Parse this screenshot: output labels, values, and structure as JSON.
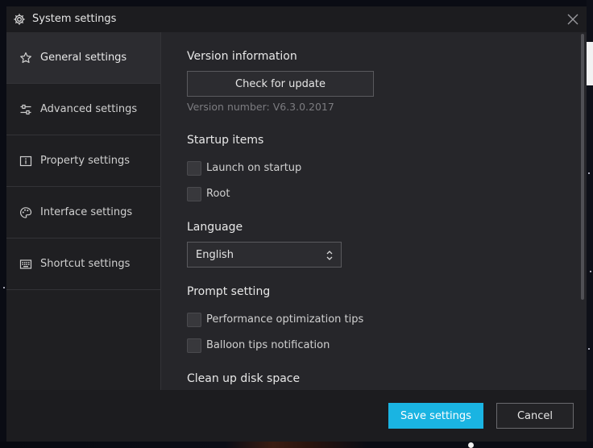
{
  "window": {
    "title": "System settings"
  },
  "icons": {
    "title": "gear-icon",
    "close": "close-icon",
    "general": "star-icon",
    "advanced": "sliders-icon",
    "property": "info-icon",
    "interface": "palette-icon",
    "shortcut": "keyboard-icon",
    "select": "chevron-up-down-icon"
  },
  "sidebar": {
    "items": [
      {
        "label": "General settings",
        "active": true
      },
      {
        "label": "Advanced settings",
        "active": false
      },
      {
        "label": "Property settings",
        "active": false
      },
      {
        "label": "Interface settings",
        "active": false
      },
      {
        "label": "Shortcut settings",
        "active": false
      }
    ]
  },
  "main": {
    "version_info": {
      "title": "Version information",
      "update_button": "Check for update",
      "version_number": "Version number: V6.3.0.2017"
    },
    "startup": {
      "title": "Startup items",
      "options": [
        {
          "label": "Launch on startup",
          "checked": false
        },
        {
          "label": "Root",
          "checked": false
        }
      ]
    },
    "language": {
      "title": "Language",
      "selected": "English"
    },
    "prompt": {
      "title": "Prompt setting",
      "options": [
        {
          "label": "Performance optimization tips",
          "checked": false
        },
        {
          "label": "Balloon tips notification",
          "checked": false
        }
      ]
    },
    "cleanup": {
      "title": "Clean up disk space"
    }
  },
  "footer": {
    "save_label": "Save settings",
    "cancel_label": "Cancel"
  },
  "colors": {
    "accent": "#1ab4e2",
    "window_bg": "#26262a",
    "titlebar_bg": "#1c1c1f",
    "sidebar_bg": "#1f1f22",
    "sidebar_active_bg": "#2c2c30"
  }
}
